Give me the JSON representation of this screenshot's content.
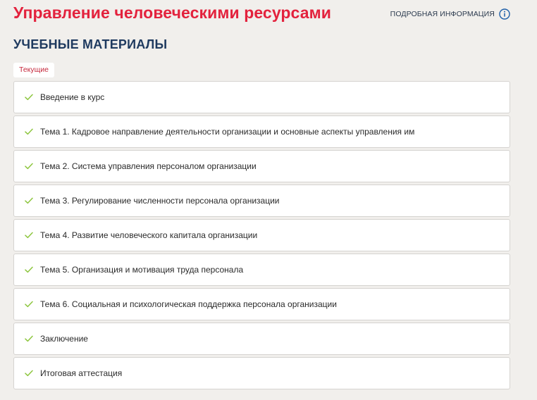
{
  "course": {
    "title": "Управление человеческими ресурсами",
    "more_info_label": "ПОДРОБНАЯ ИНФОРМАЦИЯ",
    "more_info_icon": "info-circle-icon"
  },
  "materials": {
    "title": "УЧЕБНЫЕ МАТЕРИАЛЫ",
    "current_tab": "Текущие",
    "items": [
      {
        "label": "Введение в курс",
        "status": "completed",
        "icon": "check-icon"
      },
      {
        "label": "Тема 1. Кадровое направление деятельности организации и основные аспекты управления им",
        "status": "completed",
        "icon": "check-icon"
      },
      {
        "label": "Тема 2. Система управления персоналом организации",
        "status": "completed",
        "icon": "check-icon"
      },
      {
        "label": "Тема 3. Регулирование численности персонала организации",
        "status": "completed",
        "icon": "check-icon"
      },
      {
        "label": "Тема 4. Развитие человеческого капитала организации",
        "status": "completed",
        "icon": "check-icon"
      },
      {
        "label": "Тема 5. Организация и мотивация труда персонала",
        "status": "completed",
        "icon": "check-icon"
      },
      {
        "label": "Тема 6. Социальная и психологическая поддержка персонала организации",
        "status": "completed",
        "icon": "check-icon"
      },
      {
        "label": "Заключение",
        "status": "completed",
        "icon": "check-icon"
      },
      {
        "label": "Итоговая аттестация",
        "status": "completed",
        "icon": "check-icon"
      }
    ]
  },
  "colors": {
    "title_red": "#e3223d",
    "heading_blue": "#1f3a5f",
    "check_green": "#8dc63f",
    "background": "#f1efec"
  }
}
